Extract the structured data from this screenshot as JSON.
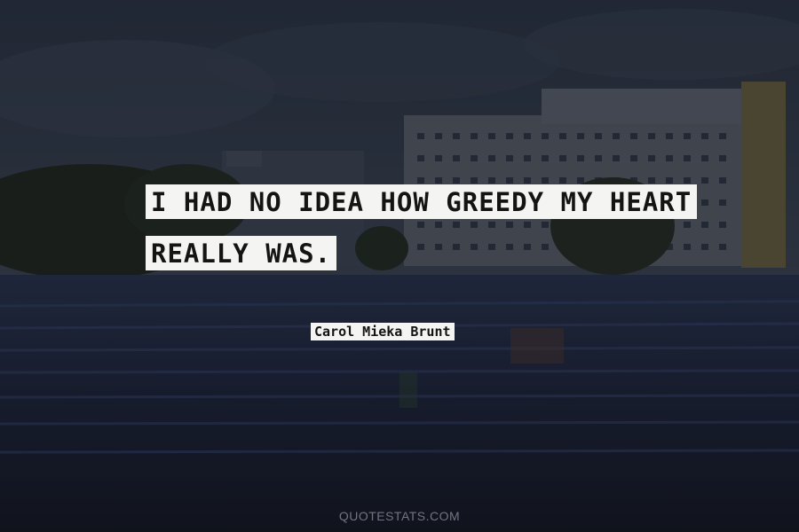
{
  "quote": {
    "line1": "I HAD NO IDEA HOW GREEDY MY HEART",
    "line2": "REALLY WAS."
  },
  "author": "Carol Mieka Brunt",
  "watermark": "QUOTESTATS.COM",
  "colors": {
    "overlay": "#1a1e2a",
    "text_box": "#f4f4f2",
    "text": "#141414",
    "watermark": "#6e7586"
  }
}
